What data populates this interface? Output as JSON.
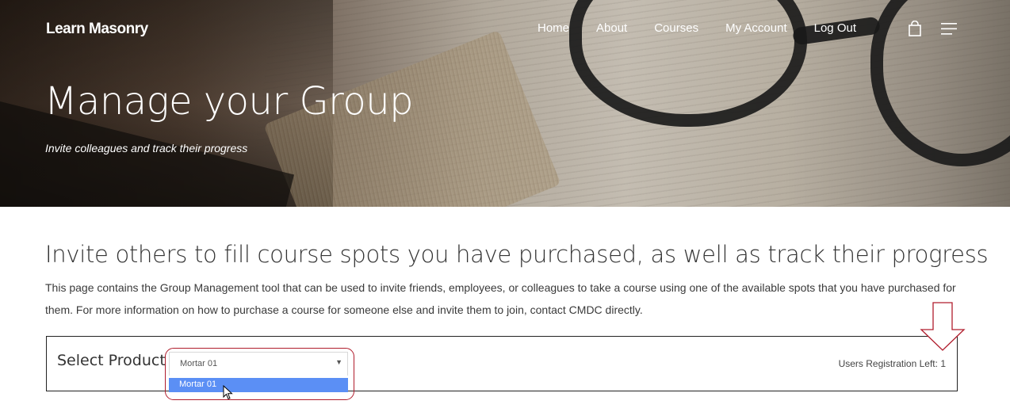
{
  "header": {
    "logo": "Learn Masonry",
    "nav": [
      "Home",
      "About",
      "Courses",
      "My Account",
      "Log Out"
    ],
    "icons": [
      "cart-icon",
      "menu-icon"
    ]
  },
  "hero": {
    "title": "Manage your Group",
    "subtitle": "Invite colleagues and track their progress"
  },
  "main": {
    "heading": "Invite others to fill course spots you have purchased, as well as track their progress",
    "description": "This page contains the Group Management tool that can be used to invite friends, employees, or colleagues to take a course using one of the available spots that you have purchased for them. For more information on how to purchase a course for someone else and invite them to join, contact CMDC directly."
  },
  "product_selector": {
    "label": "Select Product",
    "selected_value": "Mortar 01",
    "options": [
      "Mortar 01"
    ],
    "registration_label": "Users Registration Left:",
    "registration_count": "1"
  },
  "colors": {
    "option_highlight": "#5b8ff5",
    "annotation_red": "#b01c2c"
  }
}
